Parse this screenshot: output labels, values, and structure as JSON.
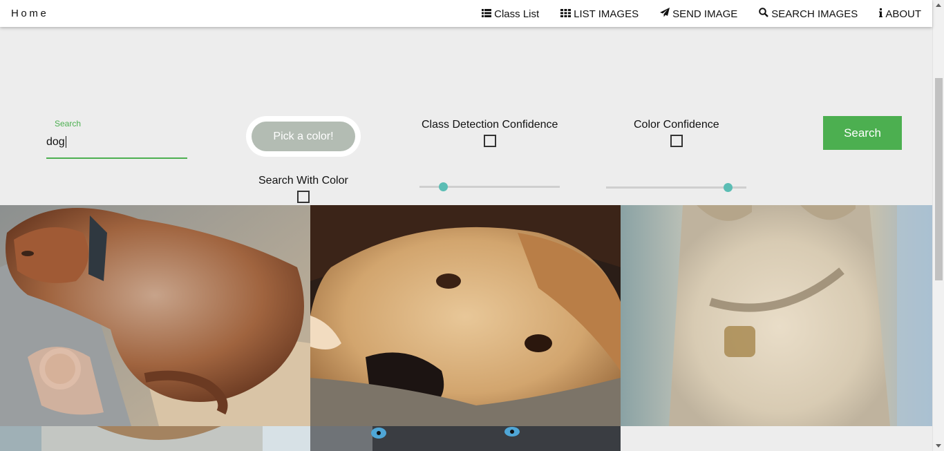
{
  "nav": {
    "brand": "Home",
    "links": [
      {
        "label": "Class List",
        "icon": "list-icon"
      },
      {
        "label": "LIST IMAGES",
        "icon": "grid-icon"
      },
      {
        "label": "SEND IMAGE",
        "icon": "paper-plane-icon"
      },
      {
        "label": "SEARCH IMAGES",
        "icon": "search-icon"
      },
      {
        "label": "ABOUT",
        "icon": "info-icon"
      }
    ]
  },
  "search": {
    "label": "Search",
    "value": "dog",
    "color_button": "Pick a color!",
    "search_with_color_label": "Search With Color",
    "class_confidence_label": "Class Detection Confidence",
    "color_confidence_label": "Color Confidence",
    "class_confidence_value": 0.17,
    "color_confidence_value": 0.87,
    "submit_label": "Search"
  },
  "results": [
    {
      "name": "dog-sleeping-lap"
    },
    {
      "name": "golden-retriever-lying"
    },
    {
      "name": "blurry-dog-bell-collar"
    },
    {
      "name": "dog-partial-row2"
    },
    {
      "name": "husky-partial-row2"
    }
  ],
  "colors": {
    "accent": "#4caf50",
    "slider_thumb": "#5bbdb4",
    "color_button": "#b3bcb3"
  }
}
